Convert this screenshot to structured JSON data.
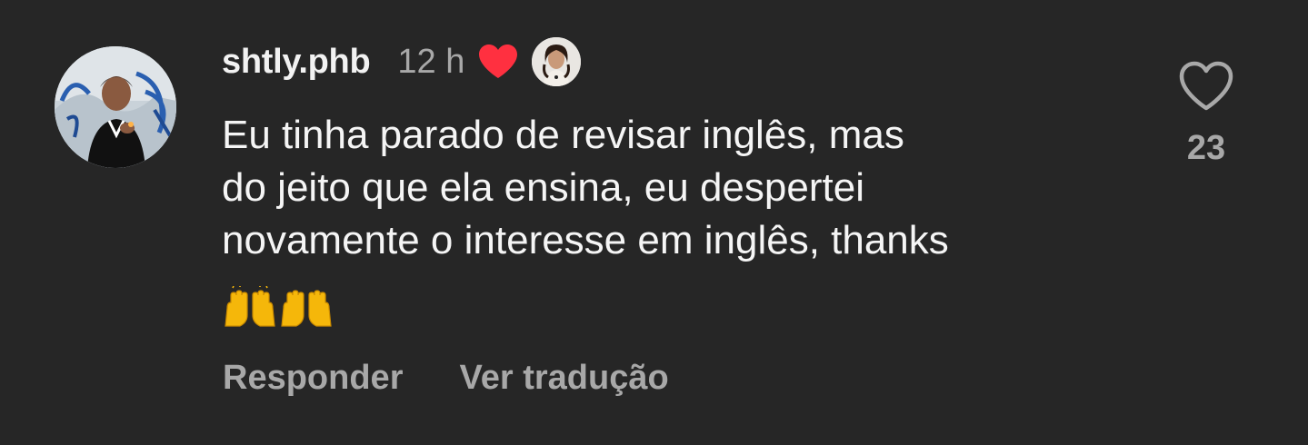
{
  "comment": {
    "username": "shtly.phb",
    "time": "12 h",
    "text_lines": [
      "Eu tinha parado de revisar inglês, mas",
      "do jeito que ela ensina, eu despertei",
      "novamente o interesse em inglês, thanks"
    ],
    "emojis": [
      "🙌",
      "🙌",
      "🙌",
      "🙌"
    ],
    "creator_liked": true,
    "like_count": "23"
  },
  "actions": {
    "reply_label": "Responder",
    "translate_label": "Ver tradução"
  },
  "icons": {
    "like": "heart-outline-icon",
    "creator_like": "heart-filled-icon"
  },
  "colors": {
    "background": "#262626",
    "heart_red": "#ff3040",
    "muted_text": "#a8a8a8",
    "primary_text": "#f5f5f5"
  }
}
